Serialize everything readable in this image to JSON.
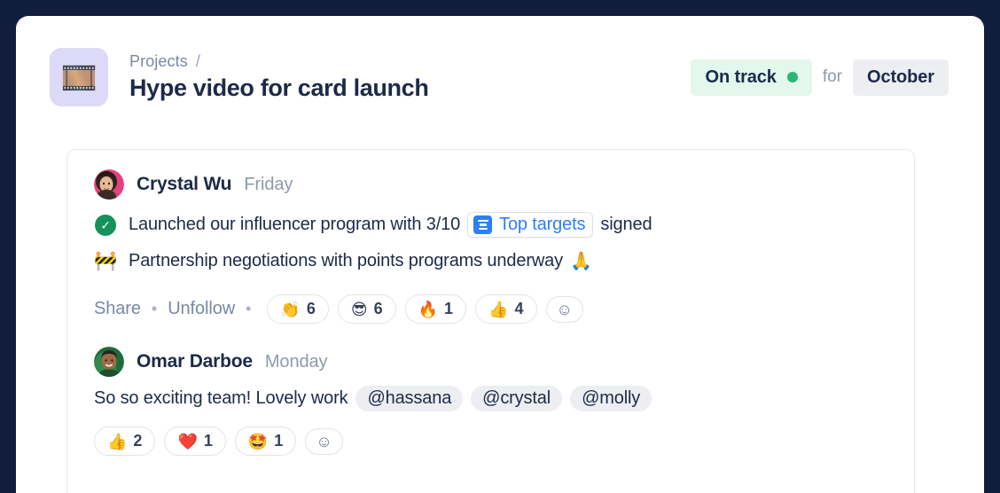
{
  "header": {
    "project_icon": "film-frames-icon",
    "project_icon_glyph": "🎞️",
    "breadcrumb_parent": "Projects",
    "breadcrumb_separator": "/",
    "title": "Hype video for card launch",
    "status_label": "On track",
    "status_color": "#2bb673",
    "for_label": "for",
    "period_label": "October"
  },
  "post": {
    "author": "Crystal Wu",
    "timestamp": "Friday",
    "lines": [
      {
        "icon": "green-check-icon",
        "text_before": "Launched our influencer program with 3/10",
        "chip_label": "Top targets",
        "chip_icon": "goal-icon",
        "text_after": "signed"
      },
      {
        "icon": "construction-barrier-emoji",
        "icon_glyph": "🚧",
        "text_before": "Partnership negotiations with points programs underway",
        "trailing_emoji": "🙏"
      }
    ],
    "actions": {
      "share_label": "Share",
      "unfollow_label": "Unfollow",
      "separator": "•"
    },
    "reactions": [
      {
        "emoji": "👏",
        "name": "clap-reaction",
        "count": "6"
      },
      {
        "emoji": "😎",
        "name": "sunglasses-reaction",
        "count": "6"
      },
      {
        "emoji": "🔥",
        "name": "fire-reaction",
        "count": "1"
      },
      {
        "emoji": "👍",
        "name": "thumbsup-reaction",
        "count": "4"
      }
    ],
    "add_reaction_glyph": "☺"
  },
  "comment": {
    "author": "Omar Darboe",
    "timestamp": "Monday",
    "text": "So so exciting team! Lovely work",
    "mentions": [
      "@hassana",
      "@crystal",
      "@molly"
    ],
    "reactions": [
      {
        "emoji": "👍",
        "name": "thumbsup-reaction",
        "count": "2"
      },
      {
        "emoji": "❤️",
        "name": "heart-reaction",
        "count": "1"
      },
      {
        "emoji": "🤩",
        "name": "star-struck-reaction",
        "count": "1"
      }
    ],
    "add_reaction_glyph": "☺"
  }
}
